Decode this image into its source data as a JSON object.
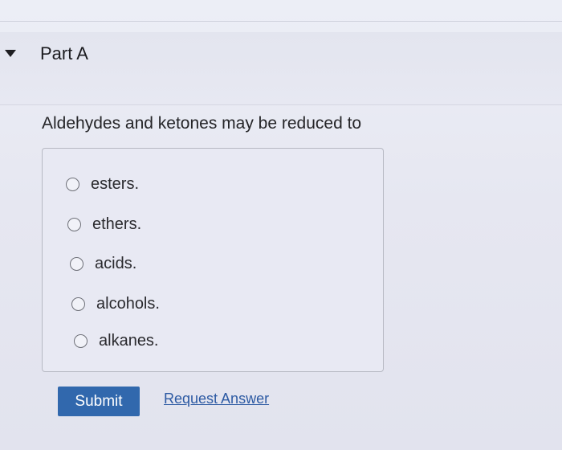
{
  "part": {
    "title": "Part A",
    "toggle_icon": "caret-down-icon"
  },
  "question": {
    "prompt": "Aldehydes and ketones may be reduced to",
    "options": [
      {
        "label": "esters."
      },
      {
        "label": "ethers."
      },
      {
        "label": "acids."
      },
      {
        "label": "alcohols."
      },
      {
        "label": "alkanes."
      }
    ]
  },
  "actions": {
    "submit_label": "Submit",
    "request_answer_label": "Request Answer"
  },
  "colors": {
    "submit_background": "#3168ad",
    "link": "#2d5aa3"
  }
}
